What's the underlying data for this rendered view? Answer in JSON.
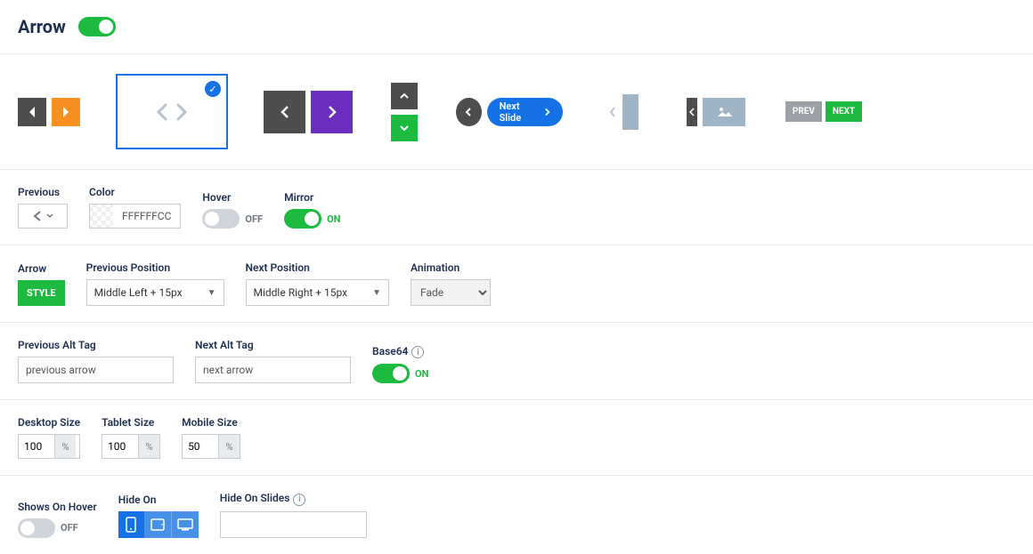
{
  "header": {
    "title": "Arrow",
    "enabled": true
  },
  "styles": {
    "pill_label": "Next Slide",
    "prev_tag": "PREV",
    "next_tag": "NEXT"
  },
  "row1": {
    "previous_label": "Previous",
    "color_label": "Color",
    "color_value": "FFFFFFCC",
    "hover_label": "Hover",
    "hover_state": "OFF",
    "mirror_label": "Mirror",
    "mirror_state": "ON"
  },
  "row2": {
    "arrow_label": "Arrow",
    "style_button": "STYLE",
    "prev_pos_label": "Previous Position",
    "prev_pos_value": "Middle Left + 15px",
    "next_pos_label": "Next Position",
    "next_pos_value": "Middle Right + 15px",
    "animation_label": "Animation",
    "animation_value": "Fade"
  },
  "row3": {
    "prev_alt_label": "Previous Alt Tag",
    "prev_alt_value": "previous arrow",
    "next_alt_label": "Next Alt Tag",
    "next_alt_value": "next arrow",
    "base64_label": "Base64",
    "base64_state": "ON"
  },
  "row4": {
    "desktop_label": "Desktop Size",
    "desktop_value": "100",
    "tablet_label": "Tablet Size",
    "tablet_value": "100",
    "mobile_label": "Mobile Size",
    "mobile_value": "50",
    "unit": "%"
  },
  "row5": {
    "shows_label": "Shows On Hover",
    "shows_state": "OFF",
    "hide_on_label": "Hide On",
    "hide_slides_label": "Hide On Slides"
  }
}
